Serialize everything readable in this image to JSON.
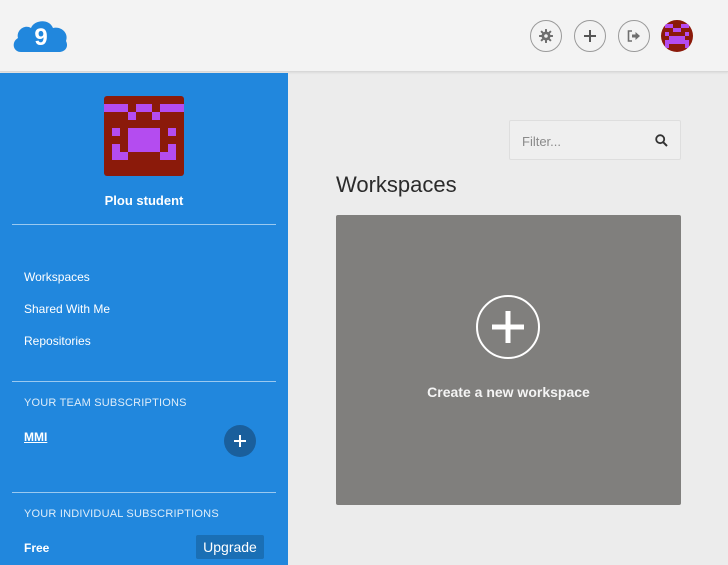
{
  "header": {
    "logo_text": "9",
    "icons": {
      "settings": "gear-icon",
      "add": "plus-icon",
      "logout": "sign-out-icon"
    }
  },
  "sidebar": {
    "username": "Plou student",
    "nav": [
      {
        "label": "Workspaces"
      },
      {
        "label": "Shared With Me"
      },
      {
        "label": "Repositories"
      }
    ],
    "team_section_title": "YOUR TEAM SUBSCRIPTIONS",
    "team_name": "MMI",
    "individual_section_title": "YOUR INDIVIDUAL SUBSCRIPTIONS",
    "plan": "Free",
    "upgrade_label": "Upgrade"
  },
  "main": {
    "filter_placeholder": "Filter...",
    "title": "Workspaces",
    "create_label": "Create a new workspace"
  },
  "colors": {
    "sidebar": "#2187dd",
    "card": "#807f7d",
    "avatar_dark": "#8b1a0a",
    "avatar_light": "#b44cf0"
  }
}
